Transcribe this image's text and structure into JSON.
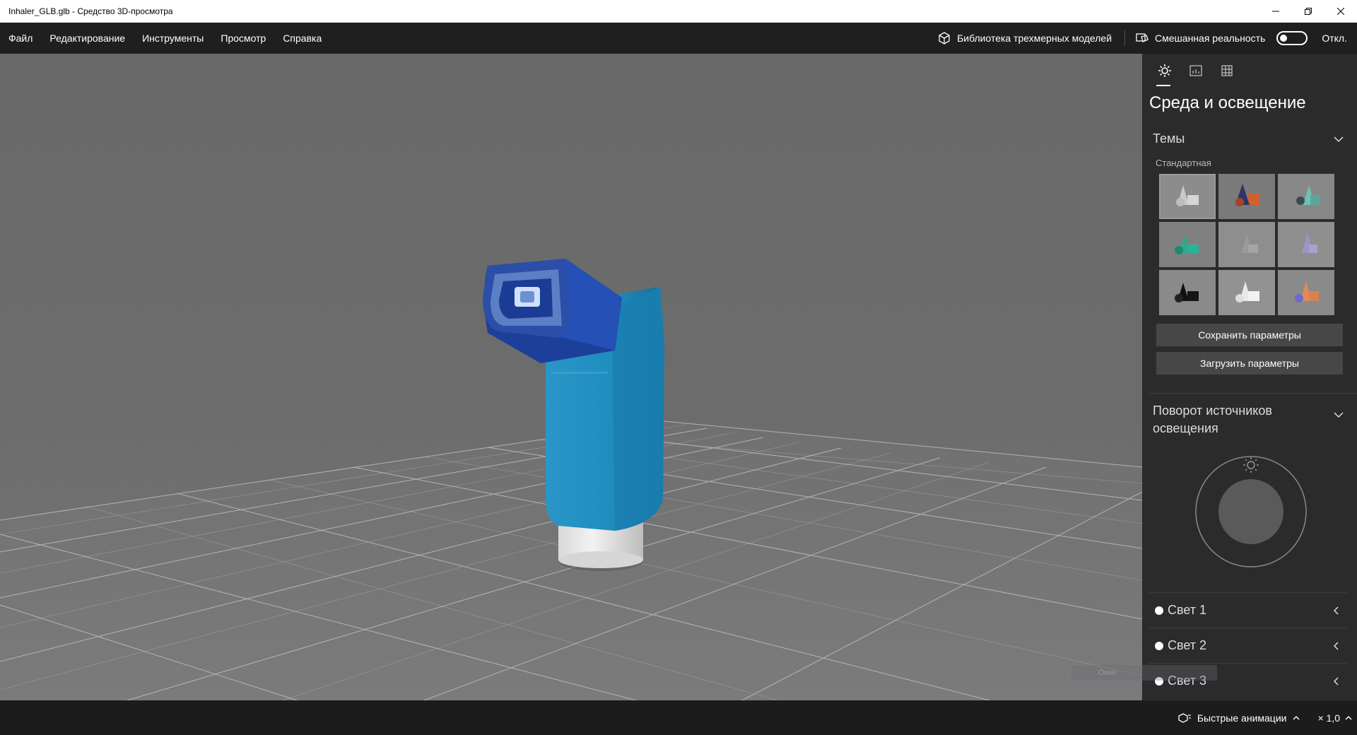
{
  "window": {
    "title": "Inhaler_GLB.glb - Средство 3D-просмотра"
  },
  "menu": {
    "items": [
      "Файл",
      "Редактирование",
      "Инструменты",
      "Просмотр",
      "Справка"
    ],
    "library": "Библиотека трехмерных моделей",
    "mixed_reality": "Смешанная реальность",
    "toggle_state": "Откл."
  },
  "panel": {
    "title": "Среда и освещение",
    "themes_label": "Темы",
    "themes_sub": "Стандартная",
    "save_btn": "Сохранить параметры",
    "load_btn": "Загрузить параметры",
    "rotation_label": "Поворот источников освещения",
    "lights": [
      "Свет 1",
      "Свет 2",
      "Свет 3"
    ]
  },
  "ghost_text": "Окно",
  "bottom": {
    "animation": "Быстрые анимации",
    "speed": "× 1,0"
  },
  "colors": {
    "inhaler_body": "#1f8fbf",
    "inhaler_mouth": "#1c3f9a",
    "canister": "#e8e8e8",
    "panel_bg": "#2b2b2b"
  }
}
